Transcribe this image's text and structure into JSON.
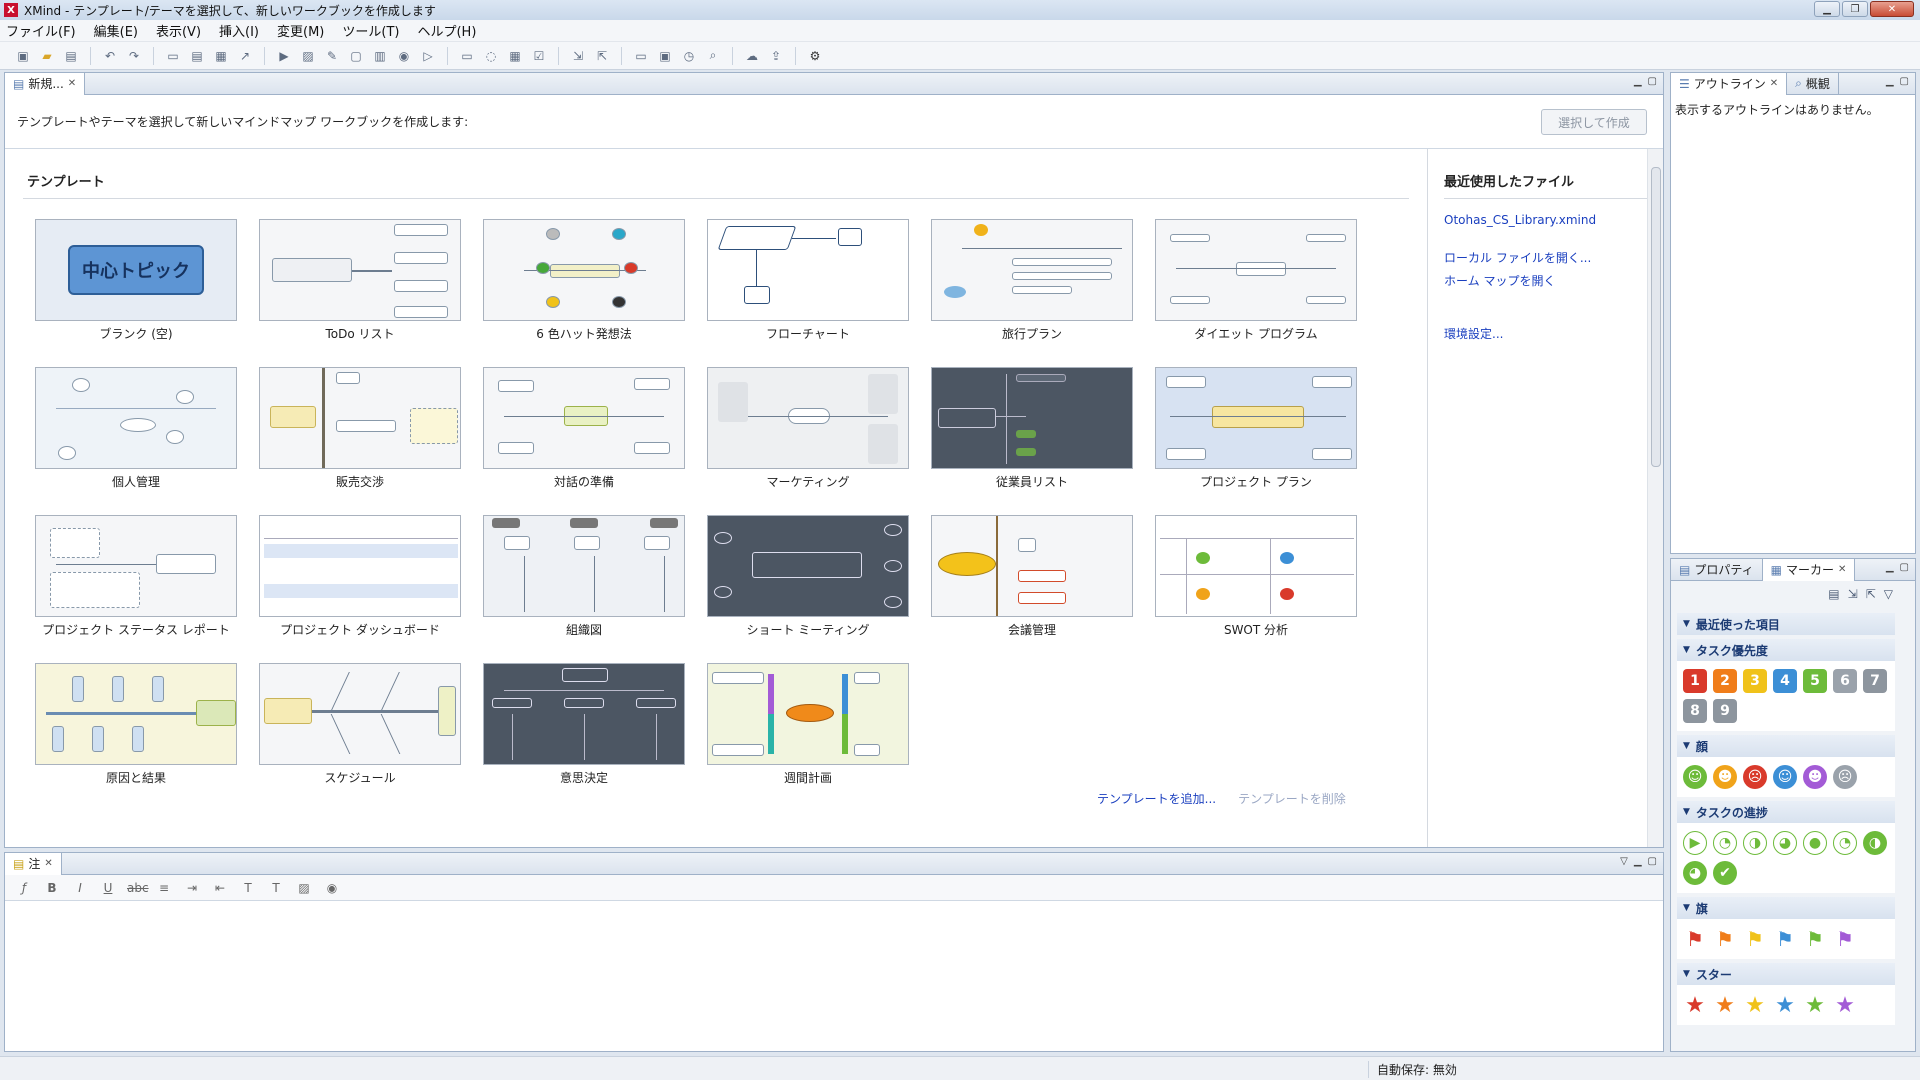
{
  "window": {
    "title": "XMind - テンプレート/テーマを選択して、新しいワークブックを作成します",
    "app_icon": "X"
  },
  "menu": [
    "ファイル(F)",
    "編集(E)",
    "表示(V)",
    "挿入(I)",
    "変更(M)",
    "ツール(T)",
    "ヘルプ(H)"
  ],
  "editor": {
    "tab_label": "新規...",
    "instruction": "テンプレートやテーマを選択して新しいマインドマップ ワークブックを作成します:",
    "create_button": "選択して作成",
    "section_title": "テンプレート",
    "templates": [
      {
        "label": "ブランク (空)",
        "center": "中心トピック"
      },
      {
        "label": "ToDo リスト"
      },
      {
        "label": "6 色ハット発想法"
      },
      {
        "label": "フローチャート"
      },
      {
        "label": "旅行プラン"
      },
      {
        "label": "ダイエット プログラム"
      },
      {
        "label": "個人管理"
      },
      {
        "label": "販売交渉"
      },
      {
        "label": "対話の準備"
      },
      {
        "label": "マーケティング"
      },
      {
        "label": "従業員リスト"
      },
      {
        "label": "プロジェクト プラン"
      },
      {
        "label": "プロジェクト ステータス レポート"
      },
      {
        "label": "プロジェクト ダッシュボード"
      },
      {
        "label": "組織図"
      },
      {
        "label": "ショート ミーティング"
      },
      {
        "label": "会議管理"
      },
      {
        "label": "SWOT 分析"
      },
      {
        "label": "原因と結果"
      },
      {
        "label": "スケジュール"
      },
      {
        "label": "意思決定"
      },
      {
        "label": "週間計画"
      }
    ],
    "add_template_link": "テンプレートを追加...",
    "remove_template_link": "テンプレートを削除",
    "recent": {
      "title": "最近使用したファイル",
      "file": "Otohas_CS_Library.xmind",
      "open_local": "ローカル ファイルを開く...",
      "open_home": "ホーム マップを開く",
      "settings": "環境設定..."
    }
  },
  "notes": {
    "tab_label": "注"
  },
  "outline": {
    "tab_label": "アウトライン",
    "overview_label": "概観",
    "empty_message": "表示するアウトラインはありません。"
  },
  "props": {
    "tab_label": "プロパティ",
    "markers_label": "マーカー",
    "sections": [
      {
        "title": "最近使った項目",
        "items": []
      },
      {
        "title": "タスク優先度",
        "items": [
          "1",
          "2",
          "3",
          "4",
          "5",
          "6",
          "7",
          "8",
          "9"
        ]
      },
      {
        "title": "顔",
        "items": [
          "☺",
          "☻",
          "☹",
          "☺",
          "☻",
          "☹"
        ]
      },
      {
        "title": "タスクの進捗",
        "items": [
          "▶",
          "◔",
          "◑",
          "◕",
          "●",
          "◔",
          "◑",
          "◕",
          "✔"
        ]
      },
      {
        "title": "旗",
        "items": [
          "⚑",
          "⚑",
          "⚑",
          "⚑",
          "⚑",
          "⚑"
        ]
      },
      {
        "title": "スター",
        "items": [
          "★",
          "★",
          "★",
          "★",
          "★",
          "★"
        ]
      }
    ],
    "priority_colors": [
      "#d93a2b",
      "#f07d1a",
      "#f0c21a",
      "#3c8fd6",
      "#6dbb3a",
      "#9aa2ab",
      "#8d959e",
      "#8d959e",
      "#8d959e"
    ],
    "face_colors": [
      "#6dbb3a",
      "#f0a31a",
      "#d93a2b",
      "#3c8fd6",
      "#a35bd6",
      "#9aa2ab"
    ],
    "progress_colors": [
      "#6dbb3a"
    ],
    "flag_colors": [
      "#d93a2b",
      "#f07d1a",
      "#f0c21a",
      "#3c8fd6",
      "#6dbb3a",
      "#a35bd6"
    ],
    "star_colors": [
      "#d93a2b",
      "#f07d1a",
      "#f0c21a",
      "#3c8fd6",
      "#6dbb3a",
      "#a35bd6"
    ]
  },
  "status": {
    "autosave": "自動保存: 無効"
  }
}
